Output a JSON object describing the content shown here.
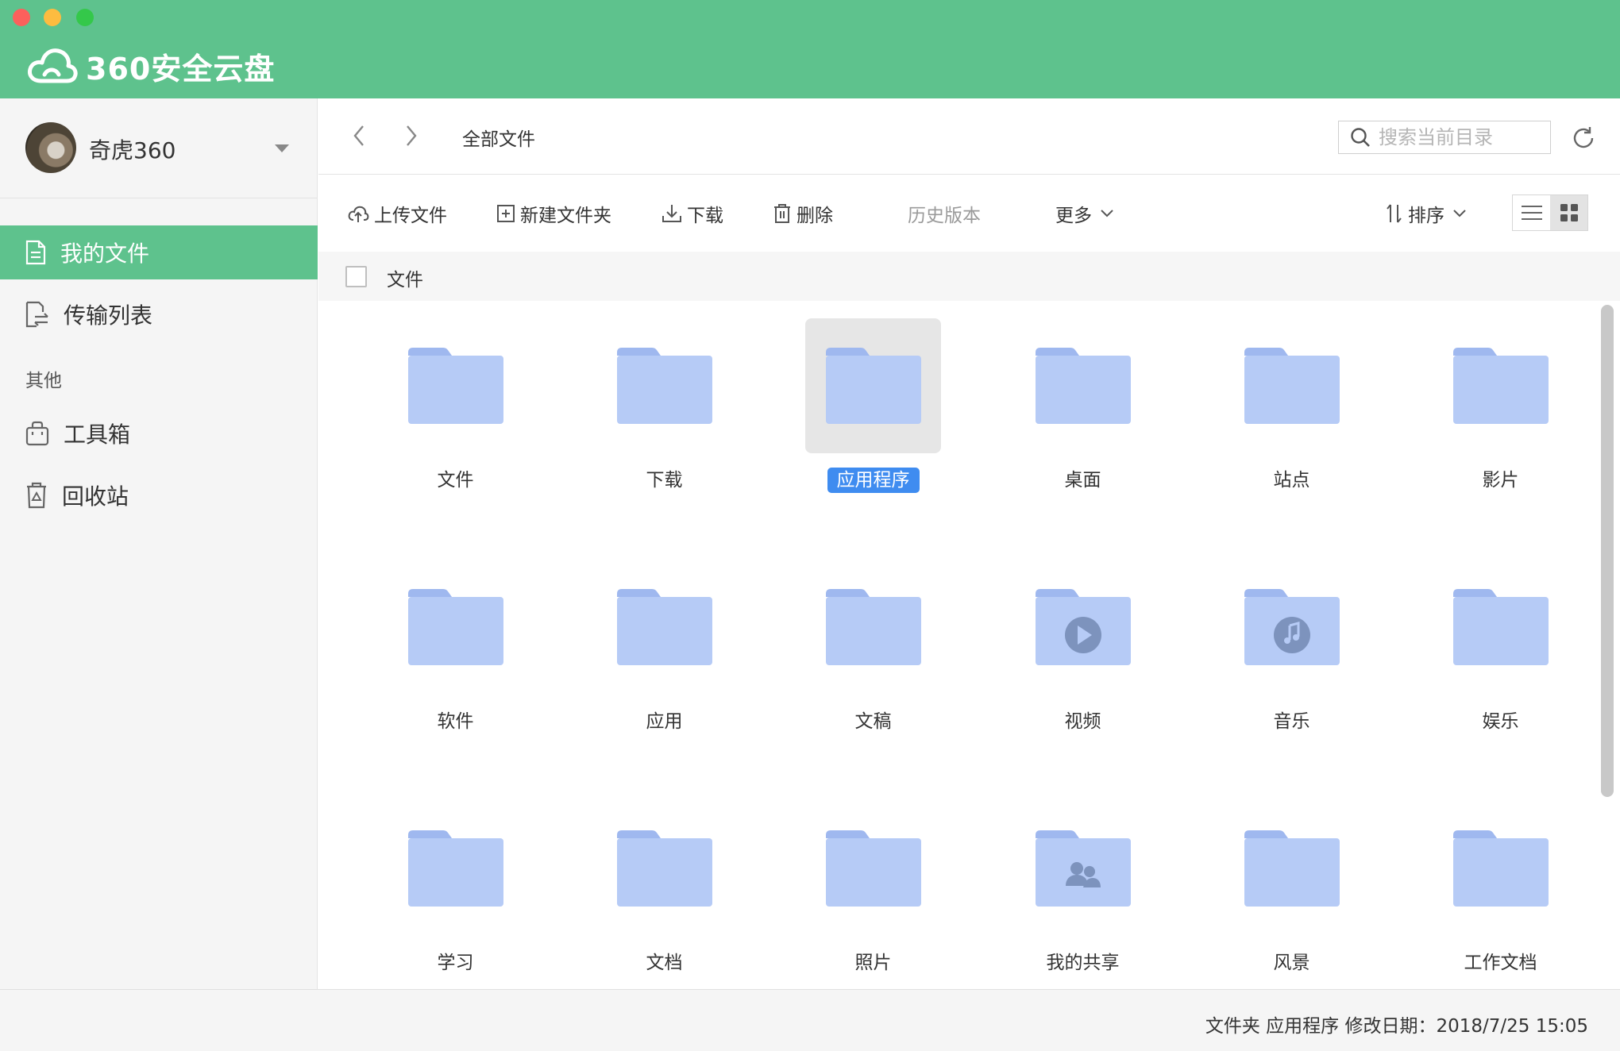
{
  "app": {
    "title": "360安全云盘"
  },
  "user": {
    "name": "奇虎360"
  },
  "sidebar": {
    "items": [
      {
        "label": "我的文件",
        "active": true
      },
      {
        "label": "传输列表",
        "active": false
      }
    ],
    "section_other": "其他",
    "other_items": [
      {
        "label": "工具箱"
      },
      {
        "label": "回收站"
      }
    ]
  },
  "pathbar": {
    "breadcrumb": "全部文件",
    "search_placeholder": "搜索当前目录"
  },
  "toolbar": {
    "upload": "上传文件",
    "new_folder": "新建文件夹",
    "download": "下载",
    "delete": "删除",
    "history": "历史版本",
    "more": "更多",
    "sort": "排序"
  },
  "list_header": {
    "label": "文件"
  },
  "folders": [
    {
      "name": "文件",
      "kind": "plain"
    },
    {
      "name": "下载",
      "kind": "plain"
    },
    {
      "name": "应用程序",
      "kind": "plain",
      "selected": true
    },
    {
      "name": "桌面",
      "kind": "plain"
    },
    {
      "name": "站点",
      "kind": "plain"
    },
    {
      "name": "影片",
      "kind": "plain"
    },
    {
      "name": "软件",
      "kind": "plain"
    },
    {
      "name": "应用",
      "kind": "plain"
    },
    {
      "name": "文稿",
      "kind": "plain"
    },
    {
      "name": "视频",
      "kind": "video"
    },
    {
      "name": "音乐",
      "kind": "music"
    },
    {
      "name": "娱乐",
      "kind": "plain"
    },
    {
      "name": "学习",
      "kind": "plain"
    },
    {
      "name": "文档",
      "kind": "plain"
    },
    {
      "name": "照片",
      "kind": "plain"
    },
    {
      "name": "我的共享",
      "kind": "shared"
    },
    {
      "name": "风景",
      "kind": "plain"
    },
    {
      "name": "工作文档",
      "kind": "plain"
    }
  ],
  "status": {
    "text": "文件夹 应用程序   修改日期：2018/7/25 15:05"
  },
  "colors": {
    "accent": "#5ec28d",
    "folder": "#b6cbf6",
    "folder_tab": "#9fb8ef",
    "selection": "#3f8cf0"
  }
}
